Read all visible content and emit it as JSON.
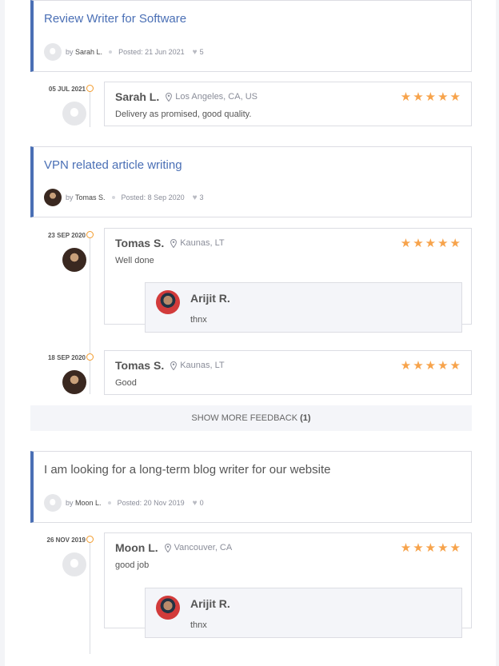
{
  "jobs": [
    {
      "title": "Review Writer for Software",
      "title_color": "#4a6fb5",
      "by": "by",
      "author": "Sarah L.",
      "posted": "Posted: 21 Jun 2021",
      "likes": "5",
      "reviews": [
        {
          "date": "05 JUL 2021",
          "name": "Sarah L.",
          "location": "Los Angeles, CA, US",
          "text": "Delivery as promised, good quality.",
          "stars": "★★★★★"
        }
      ]
    },
    {
      "title": "VPN related article writing",
      "title_color": "#4a6fb5",
      "by": "by",
      "author": "Tomas S.",
      "posted": "Posted: 8 Sep 2020",
      "likes": "3",
      "reviews": [
        {
          "date": "23 SEP 2020",
          "name": "Tomas S.",
          "location": "Kaunas, LT",
          "text": "Well done",
          "stars": "★★★★★",
          "reply": {
            "name": "Arijit R.",
            "text": "thnx"
          }
        },
        {
          "date": "18 SEP 2020",
          "name": "Tomas S.",
          "location": "Kaunas, LT",
          "text": "Good",
          "stars": "★★★★★"
        }
      ],
      "show_more": {
        "label": "SHOW MORE FEEDBACK",
        "count": "(1)"
      }
    },
    {
      "title": "I am looking for a long-term blog writer for our website",
      "title_color": "#555555",
      "by": "by",
      "author": "Moon L.",
      "posted": "Posted: 20 Nov 2019",
      "likes": "0",
      "reviews": [
        {
          "date": "26 NOV 2019",
          "name": "Moon L.",
          "location": "Vancouver, CA",
          "text": "good job",
          "stars": "★★★★★",
          "reply": {
            "name": "Arijit R.",
            "text": "thnx"
          }
        }
      ]
    }
  ],
  "colors": {
    "accent": "#4a6fb5",
    "star": "#f7a34b",
    "timeline_circle": "#f39b2b"
  },
  "icons": {
    "location": "map-pin-icon",
    "like": "heart-icon",
    "star": "star-icon"
  }
}
